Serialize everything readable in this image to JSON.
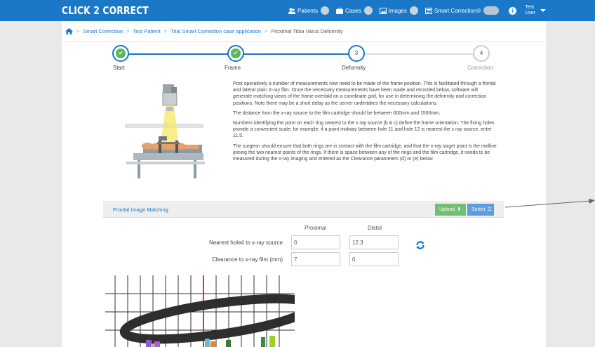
{
  "navbar": {
    "brand": "CLICK 2 CORRECT",
    "items": [
      {
        "label": "Patients",
        "badge": "",
        "icon": "users-icon"
      },
      {
        "label": "Cases",
        "badge": "",
        "icon": "briefcase-icon"
      },
      {
        "label": "Images",
        "badge": "",
        "icon": "image-icon"
      },
      {
        "label": "Smart Correction®",
        "badge": "",
        "icon": "smart-correction-icon"
      }
    ],
    "user": {
      "line1": "Test",
      "line2": "User"
    },
    "accent": "#1a78c7"
  },
  "breadcrumb": {
    "home_icon": "home-icon",
    "items": [
      "Smart Correction",
      "Test Patient",
      "Trial Smart Correction case application"
    ],
    "current": "Proximal Tibia Varus Deformity"
  },
  "wizard": {
    "steps": [
      {
        "label": "Start",
        "state": "done",
        "number": "1"
      },
      {
        "label": "Frame",
        "state": "done",
        "number": "2"
      },
      {
        "label": "Deformity",
        "state": "active",
        "number": "3"
      },
      {
        "label": "Correction",
        "state": "todo",
        "number": "4"
      }
    ],
    "colors": {
      "active": "#1a78c7",
      "done": "#5cb85c",
      "todo": "#cccccc"
    }
  },
  "instructions": {
    "paragraphs": [
      "Post operatively a number of measurements now need to be made of the frame position. This is facilitated through a frontal and lateral plain X-ray film. Once the necessary measurements have been made and recorded below, software will generate matching views of the frame overlaid on a coordinate grid, for use in determining the deformity and correction positions. Note there may be a short delay as the server undertakes the necessary calculations.",
      "The distance from the x-ray source to the film cartridge should be between 600mm and 1500mm.",
      "Numbers identifying the point on each ring nearest to the x ray source (b & c) define the frame orientation. The fixing holes provide a convenient scale; for example, if a point midway between hole 11 and hole 12 is nearest the x ray source, enter 11.5.",
      "The surgeon should ensure that both rings are in contact with the film cartridge, and that the x-ray target point is the midline joining the two nearest points of the rings. If there is space between any of the rings and the film cartridge, it needs to be measured during the x-ray imaging and entered as the Clearance parameters (d) or (e) below."
    ]
  },
  "frontal": {
    "title": "Frontal Image Matching",
    "upload_label": "Upload",
    "select_label": "Select"
  },
  "form": {
    "col_proximal": "Proximal",
    "col_distal": "Distal",
    "rows": [
      {
        "label": "Nearest hole# to x-ray source",
        "proximal": "0",
        "distal": "12.3"
      },
      {
        "label": "Clearance to x-ray film (mm)",
        "proximal": "7",
        "distal": "0"
      }
    ]
  }
}
